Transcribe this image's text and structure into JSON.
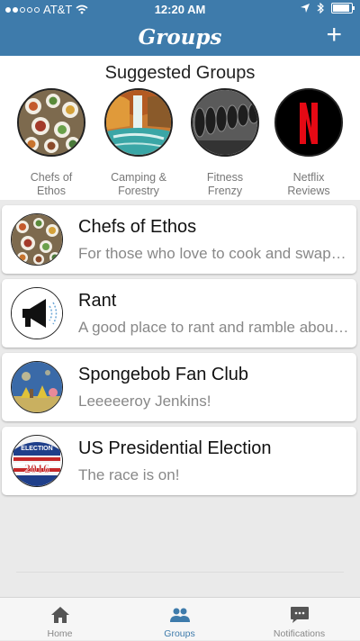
{
  "status_bar": {
    "carrier": "AT&T",
    "time": "12:20 AM"
  },
  "header": {
    "title": "Groups",
    "add_label": "+"
  },
  "suggested": {
    "title": "Suggested Groups",
    "items": [
      {
        "label_line1": "Chefs of",
        "label_line2": "Ethos"
      },
      {
        "label_line1": "Camping &",
        "label_line2": "Forestry"
      },
      {
        "label_line1": "Fitness",
        "label_line2": "Frenzy"
      },
      {
        "label_line1": "Netflix",
        "label_line2": "Reviews"
      }
    ]
  },
  "groups": [
    {
      "name": "Chefs of Ethos",
      "description": "For those who love to cook and swap recipes"
    },
    {
      "name": "Rant",
      "description": "A good place to rant and ramble about anything"
    },
    {
      "name": "Spongebob Fan Club",
      "description": "Leeeeeroy Jenkins!"
    },
    {
      "name": "US Presidential Election",
      "description": "The race is on!"
    }
  ],
  "election_badge": {
    "top": "ELECTION",
    "year": "2016"
  },
  "netflix_letter": "N",
  "tabs": [
    {
      "label": "Home",
      "icon": "home-icon"
    },
    {
      "label": "Groups",
      "icon": "groups-icon",
      "active": true
    },
    {
      "label": "Notifications",
      "icon": "notifications-icon"
    }
  ],
  "colors": {
    "brand": "#3e7bab",
    "netflix_red": "#e50914"
  }
}
